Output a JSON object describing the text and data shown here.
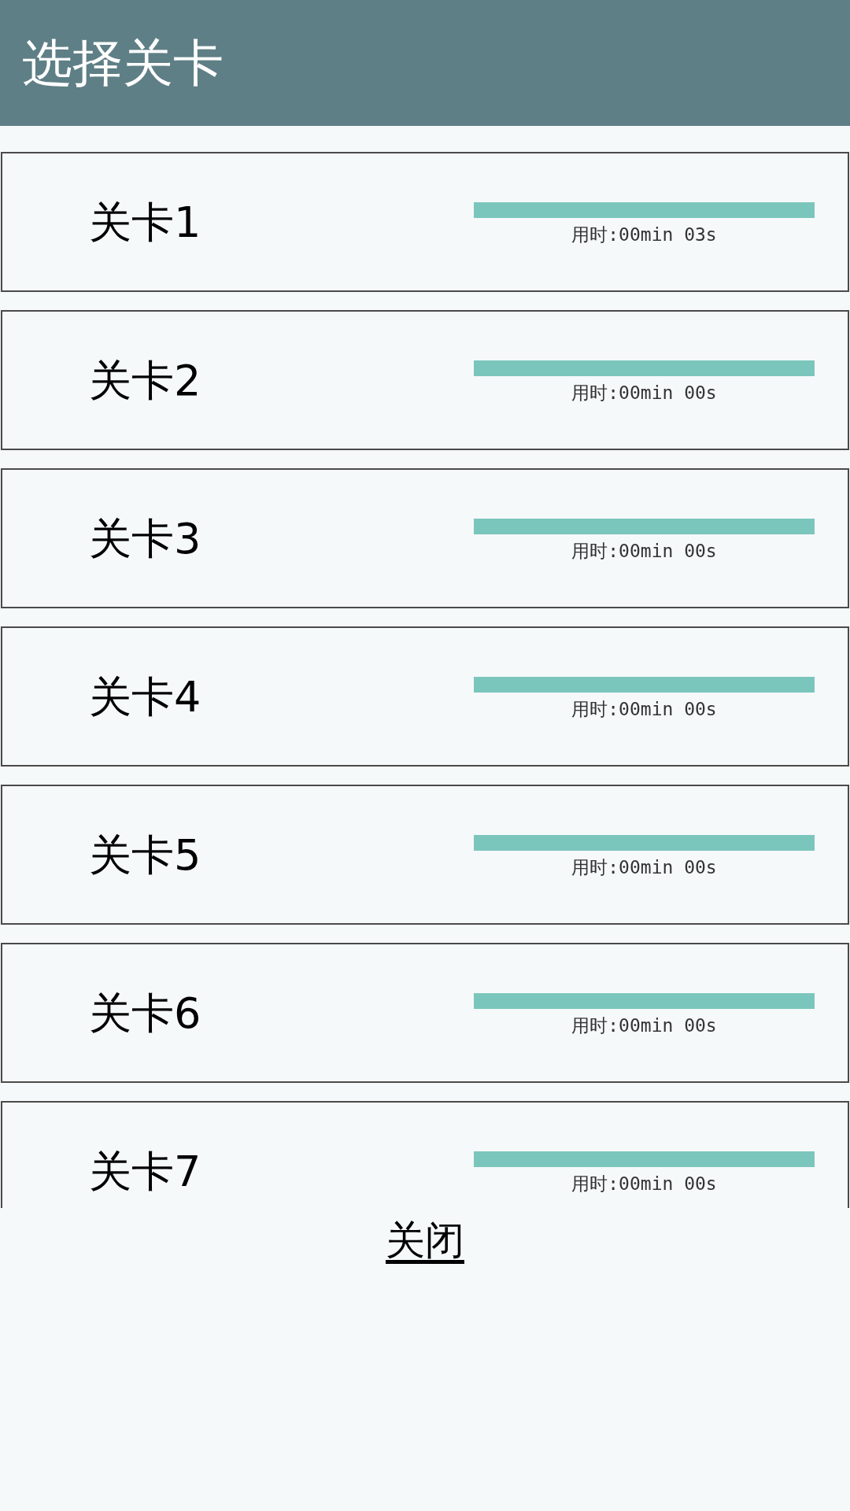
{
  "app_bar": {
    "title": "选择关卡"
  },
  "levels": [
    {
      "name": "关卡1",
      "level": 1,
      "time": "用时:00min 03s"
    },
    {
      "name": "关卡2",
      "level": 1,
      "time": "用时:00min 00s"
    },
    {
      "name": "关卡3",
      "level": 1,
      "time": "用时:00min 00s"
    },
    {
      "name": "关卡4",
      "level": 1,
      "time": "用时:00min 00s"
    },
    {
      "name": "关卡5",
      "level": 1,
      "time": "用时:00min 00s"
    },
    {
      "name": "关卡6",
      "level": 1,
      "time": "用时:00min 00s"
    },
    {
      "name": "关卡7",
      "level": 1,
      "time": "用时:00min 00s"
    }
  ],
  "close_button": "关闭"
}
